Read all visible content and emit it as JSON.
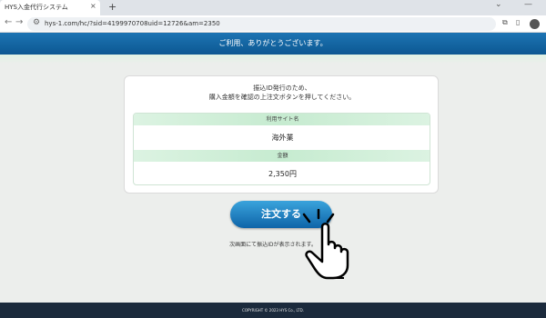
{
  "browser": {
    "tab_title": "HYS入金代行システム",
    "tab_close": "×",
    "new_tab": "+",
    "url": "hys-1.com/hc/?sid=4199970708uid=12726&am=2350",
    "back": "←",
    "forward": "→",
    "reload": "C"
  },
  "page": {
    "banner_text": "ご利用、ありがとうございます。",
    "instruction_line1": "振込ID発行のため、",
    "instruction_line2": "購入金額を確認の上注文ボタンを押してください。",
    "site_label": "利用サイト名",
    "site_value": "海外業",
    "amount_label": "金額",
    "amount_value": "2,350円",
    "order_button": "注文する",
    "note": "次画面にて振込IDが表示されます。",
    "footer": "COPYRIGHT © 2023 HYS Co., LTD."
  },
  "colors": {
    "banner": "#0c5892",
    "button": "#1b7dc1",
    "footer": "#1b2a3c"
  }
}
